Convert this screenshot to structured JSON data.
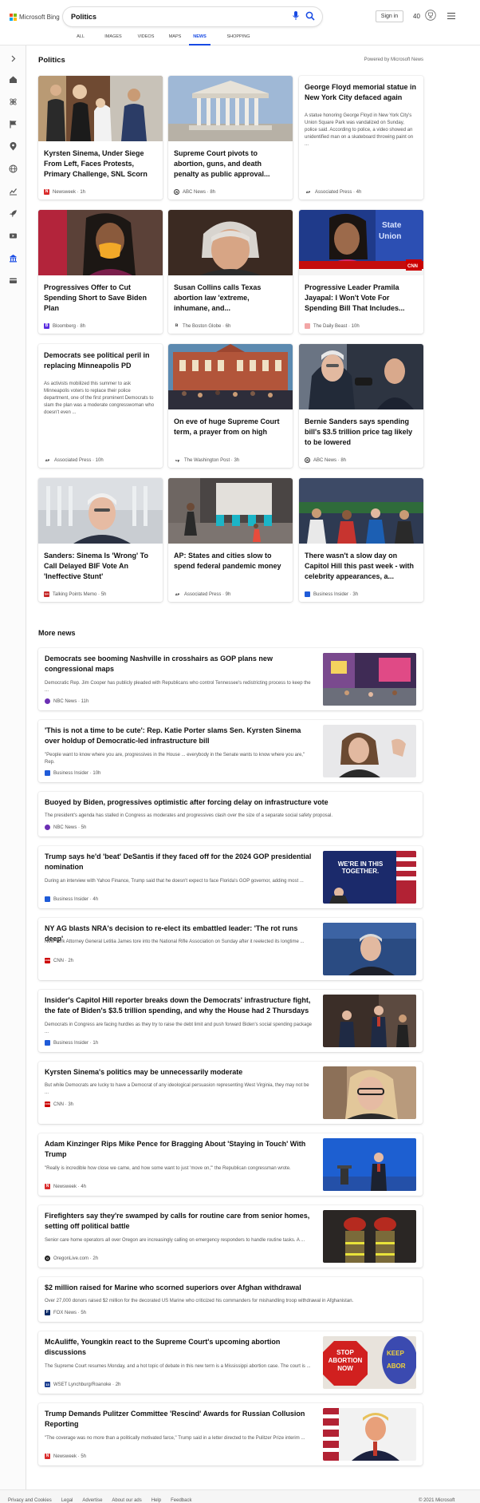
{
  "brand": {
    "name": "Microsoft Bing"
  },
  "search": {
    "query": "Politics"
  },
  "header": {
    "signin_label": "Sign in",
    "rewards_count": "40"
  },
  "tabs": [
    "ALL",
    "IMAGES",
    "VIDEOS",
    "MAPS",
    "NEWS",
    "SHOPPING"
  ],
  "active_tab": "NEWS",
  "section": {
    "title": "Politics",
    "powered_by": "Powered by Microsoft News"
  },
  "cards": [
    {
      "title": "Kyrsten Sinema, Under Siege From Left, Faces Protests, Primary Challenge, SNL Scorn",
      "source": "Newsweek · 1h",
      "logo_color": "#d92c2c",
      "logo_letter": "N"
    },
    {
      "title": "Supreme Court pivots to abortion, guns, and death penalty as public approval...",
      "source": "ABC News · 8h",
      "logo_color": "#333333",
      "logo_letter": "a"
    },
    {
      "title": "George Floyd memorial statue in New York City defaced again",
      "snippet": "A statue honoring George Floyd in New York City's Union Square Park was vandalized on Sunday, police said. According to police, a video showed an unidentified man on a skateboard throwing paint on ...",
      "source": "Associated Press · 4h",
      "logo_color": "#ffffff",
      "logo_letter": "AP"
    },
    {
      "title": "Progressives Offer to Cut Spending Short to Save Biden Plan",
      "source": "Bloomberg · 8h",
      "logo_color": "#5b2ee0",
      "logo_letter": "B"
    },
    {
      "title": "Susan Collins calls Texas abortion law 'extreme, inhumane, and...",
      "source": "The Boston Globe · 6h",
      "logo_color": "#ffffff",
      "logo_letter": "B"
    },
    {
      "title": "Progressive Leader Pramila Jayapal: I Won't Vote For Spending Bill That Includes...",
      "source": "The Daily Beast · 10h",
      "logo_color": "#f2a6a6",
      "logo_letter": ""
    },
    {
      "title": "Democrats see political peril in replacing Minneapolis PD",
      "snippet": "As activists mobilized this summer to ask Minneapolis voters to replace their police department, one of the first prominent Democrats to slam the plan was a moderate congresswoman who doesn't even ...",
      "source": "Associated Press · 10h",
      "logo_color": "#ffffff",
      "logo_letter": "AP"
    },
    {
      "title": "On eve of huge Supreme Court term, a prayer from on high",
      "source": "The Washington Post · 3h",
      "logo_color": "#ffffff",
      "logo_letter": "wp"
    },
    {
      "title": "Bernie Sanders says spending bill's $3.5 trillion price tag likely to be lowered",
      "source": "ABC News · 8h",
      "logo_color": "#333333",
      "logo_letter": "a"
    },
    {
      "title": "Sanders: Sinema Is 'Wrong' To Call Delayed BIF Vote An 'Ineffective Stunt'",
      "source": "Talking Points Memo · 5h",
      "logo_color": "#c62828",
      "logo_letter": "tpm"
    },
    {
      "title": "AP: States and cities slow to spend federal pandemic money",
      "source": "Associated Press · 9h",
      "logo_color": "#ffffff",
      "logo_letter": "AP"
    },
    {
      "title": "There wasn't a slow day on Capitol Hill this past week - with celebrity appearances, a...",
      "source": "Business Insider · 3h",
      "logo_color": "#1f5bd8",
      "logo_letter": ""
    }
  ],
  "more_news": {
    "title": "More news",
    "items": [
      {
        "title": "Democrats see booming Nashville in crosshairs as GOP plans new congressional maps",
        "snippet": "Democratic Rep. Jim Cooper has publicly pleaded with Republicans who control Tennessee's redistricting process to keep the ...",
        "source": "NBC News · 11h",
        "logo_color": "#6b2fb3",
        "logo_letter": "n"
      },
      {
        "title": "'This is not a time to be cute': Rep. Katie Porter slams Sen. Kyrsten Sinema over holdup of Democratic-led infrastructure bill",
        "snippet": "\"People want to know where you are, progressives in the House ... everybody in the Senate wants to know where you are,\" Rep.",
        "source": "Business Insider · 10h",
        "logo_color": "#1f5bd8",
        "logo_letter": ""
      },
      {
        "title": "Buoyed by Biden, progressives optimistic after forcing delay on infrastructure vote",
        "snippet": "The president's agenda has stalled in Congress as moderates and progressives clash over the size of a separate social safety proposal.",
        "source": "NBC News · 5h",
        "logo_color": "#6b2fb3",
        "logo_letter": "n"
      },
      {
        "title": "Trump says he'd 'beat' DeSantis if they faced off for the 2024 GOP presidential nomination",
        "snippet": "During an interview with Yahoo Finance, Trump said that he doesn't expect to face Florida's GOP governor, adding most ...",
        "source": "Business Insider · 4h",
        "logo_color": "#1f5bd8",
        "logo_letter": "",
        "banner": "WE'RE IN THIS TOGETHER."
      },
      {
        "title": "NY AG blasts NRA's decision to re-elect its embattled leader: 'The rot runs deep'",
        "snippet": "New York Attorney General Letitia James tore into the National Rifle Association on Sunday after it reelected its longtime ...",
        "source": "CNN · 2h",
        "logo_color": "#cc0000",
        "logo_letter": "CNN"
      },
      {
        "title": "Insider's Capitol Hill reporter breaks down the Democrats' infrastructure fight, the fate of Biden's $3.5 trillion spending, and why the House had 2 Thursdays",
        "snippet": "Democrats in Congress are facing hurdles as they try to raise the debt limit and push forward Biden's social spending package ...",
        "source": "Business Insider · 1h",
        "logo_color": "#1f5bd8",
        "logo_letter": ""
      },
      {
        "title": "Kyrsten Sinema's politics may be unnecessarily moderate",
        "snippet": "But while Democrats are lucky to have a Democrat of any ideological persuasion representing West Virginia, they may not be ...",
        "source": "CNN · 3h",
        "logo_color": "#cc0000",
        "logo_letter": "CNN"
      },
      {
        "title": "Adam Kinzinger Rips Mike Pence for Bragging About 'Staying in Touch' With Trump",
        "snippet": "\"Really is incredible how close we came, and how some want to just 'move on,'\" the Republican congressman wrote.",
        "source": "Newsweek · 4h",
        "logo_color": "#d92c2c",
        "logo_letter": "N"
      },
      {
        "title": "Firefighters say they're swamped by calls for routine care from senior homes, setting off political battle",
        "snippet": "Senior care home operators all over Oregon are increasingly calling on emergency responders to handle routine tasks. A ...",
        "source": "OregonLive.com · 2h",
        "logo_color": "#222222",
        "logo_letter": "O"
      },
      {
        "title": "$2 million raised for Marine who scorned superiors over Afghan withdrawal",
        "snippet": "Over 27,000 donors raised $2 million for the decorated US Marine who criticized his commanders for mishandling troop withdrawal in Afghanistan.",
        "source": "FOX News · 5h",
        "logo_color": "#0a2a66",
        "logo_letter": "F"
      },
      {
        "title": "McAuliffe, Youngkin react to the Supreme Court's upcoming abortion discussions",
        "snippet": "The Supreme Court resumes Monday, and a hot topic of debate in this new term is a Mississippi abortion case. The court is ...",
        "source": "WSET Lynchburg/Roanoke · 2h",
        "logo_color": "#1a3d8f",
        "logo_letter": "13",
        "banner": "STOP ABORTION NOW"
      },
      {
        "title": "Trump Demands Pulitzer Committee 'Rescind' Awards for Russian Collusion Reporting",
        "snippet": "\"The coverage was no more than a politically motivated farce,\" Trump said in a letter directed to the Pulitzer Prize interim ...",
        "source": "Newsweek · 5h",
        "logo_color": "#d92c2c",
        "logo_letter": "N"
      }
    ]
  },
  "footer": {
    "links": [
      "Privacy and Cookies",
      "Legal",
      "Advertise",
      "About our ads",
      "Help",
      "Feedback"
    ],
    "copyright": "© 2021 Microsoft"
  },
  "colors": {
    "accent": "#174ae4",
    "sidebar_icon": "#555555"
  }
}
